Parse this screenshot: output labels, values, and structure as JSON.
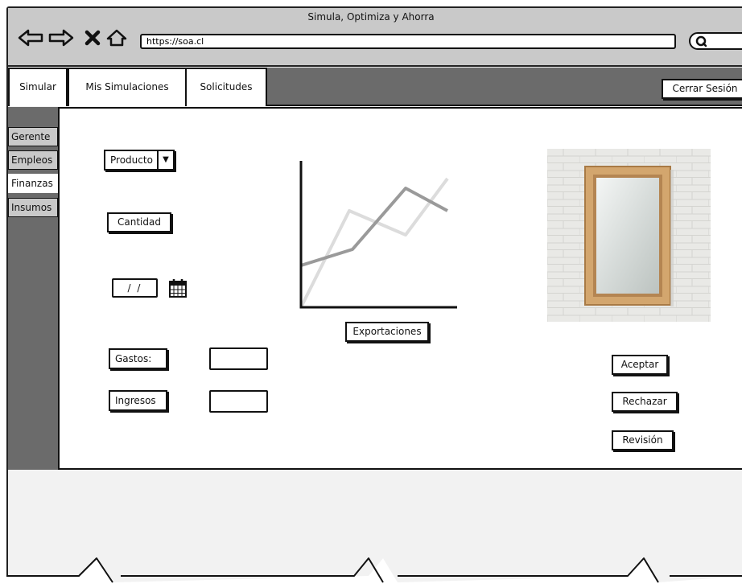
{
  "window": {
    "title": "Simula, Optimiza y Ahorra"
  },
  "toolbar": {
    "url": "https://soa.cl",
    "back_icon": "arrow-left-icon",
    "forward_icon": "arrow-right-icon",
    "stop_icon": "close-icon",
    "home_icon": "home-icon",
    "search_icon": "search-icon"
  },
  "tabs": [
    {
      "label": "Simular"
    },
    {
      "label": "Mis Simulaciones"
    },
    {
      "label": "Solicitudes"
    }
  ],
  "logout_label": "Cerrar Sesión",
  "sidebar": {
    "items": [
      {
        "label": "Gerente"
      },
      {
        "label": "Empleos"
      },
      {
        "label": "Finanzas",
        "active": true
      },
      {
        "label": "Insumos"
      }
    ]
  },
  "form": {
    "product_label": "Producto",
    "quantity_label": "Cantidad",
    "date_value": "/ /",
    "calendar_icon": "calendar-icon",
    "expenses_label": "Gastos:",
    "expenses_value": "",
    "income_label": "Ingresos",
    "income_value": ""
  },
  "chart": {
    "button_label": "Exportaciones",
    "colors": {
      "dark_series": "#9a9a9a",
      "light_series": "#dcdcdc",
      "axis": "#111111"
    }
  },
  "image": {
    "subject": "mirror-image"
  },
  "actions": {
    "accept_label": "Aceptar",
    "reject_label": "Rechazar",
    "review_label": "Revisión"
  }
}
